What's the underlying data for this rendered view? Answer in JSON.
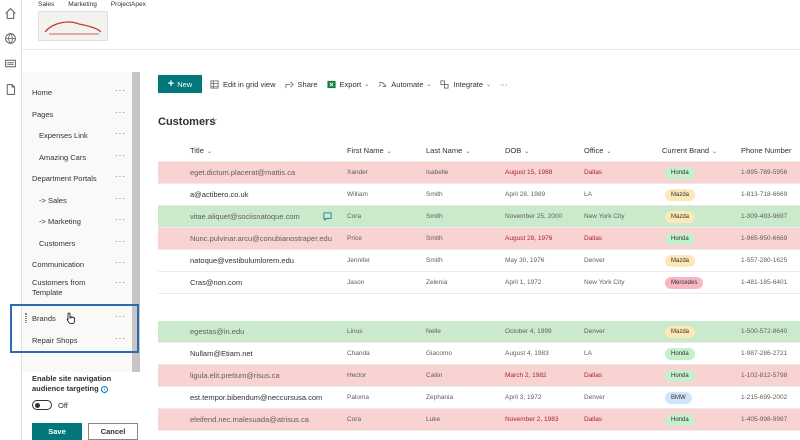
{
  "hub_nav": [
    "Sales",
    "Marketing",
    "ProjectApex"
  ],
  "left_nav": {
    "items": [
      {
        "label": "Home",
        "indent": 0
      },
      {
        "label": "Pages",
        "indent": 0
      },
      {
        "label": "Expenses Link",
        "indent": 1
      },
      {
        "label": "Amazing Cars",
        "indent": 1
      },
      {
        "label": "Department Portals",
        "indent": 0
      },
      {
        "label": "-> Sales",
        "indent": 1
      },
      {
        "label": "-> Marketing",
        "indent": 1
      },
      {
        "label": "Customers",
        "indent": 1
      },
      {
        "label": "Communication",
        "indent": 0
      },
      {
        "label": "Customers from Template",
        "indent": 0
      },
      {
        "label": "Brands",
        "indent": 0
      },
      {
        "label": "Repair Shops",
        "indent": 0
      }
    ],
    "more": "···",
    "audience_label": "Enable site navigation audience targeting",
    "info": "i",
    "toggle_state": "Off",
    "save": "Save",
    "cancel": "Cancel"
  },
  "command_bar": {
    "new": "New",
    "edit_grid": "Edit in grid view",
    "share": "Share",
    "export": "Export",
    "automate": "Automate",
    "integrate": "Integrate",
    "more": "···"
  },
  "list_title": "Customers",
  "columns": [
    "Title",
    "First Name",
    "Last Name",
    "DOB",
    "Office",
    "Current Brand",
    "Phone Number"
  ],
  "brand_colors": {
    "Honda": "#c6efce",
    "Mazda": "#fde9b8",
    "Mercedes": "#f7b6c2",
    "BMW": "#cfe4fa"
  },
  "rows": [
    {
      "color": "red",
      "title": "eget.dictum.placerat@mattis.ca",
      "first": "Xander",
      "last": "Isabelle",
      "dob": "August 15, 1988",
      "office": "Dallas",
      "brand": "Honda",
      "phone": "1-995-789-5956"
    },
    {
      "color": "none",
      "title": "a@actibero.co.uk",
      "first": "William",
      "last": "Smith",
      "dob": "April 28, 1989",
      "office": "LA",
      "brand": "Mazda",
      "phone": "1-813-718-6669"
    },
    {
      "color": "green",
      "title": "vitae.aliquet@sociisnatoque.com",
      "first": "Cora",
      "last": "Smith",
      "dob": "November 25, 2000",
      "office": "New York City",
      "brand": "Mazda",
      "phone": "1-309-493-9697",
      "comment": true
    },
    {
      "color": "red",
      "title": "Nunc.pulvinar.arcu@conubianostraper.edu",
      "first": "Price",
      "last": "Smith",
      "dob": "August 28, 1976",
      "office": "Dallas",
      "brand": "Honda",
      "phone": "1-965-950-6669"
    },
    {
      "color": "none",
      "title": "natoque@vestibulumlorem.edu",
      "first": "Jennifer",
      "last": "Smith",
      "dob": "May 30, 1976",
      "office": "Denver",
      "brand": "Mazda",
      "phone": "1-557-280-1625"
    },
    {
      "color": "none",
      "title": "Cras@non.com",
      "first": "Jason",
      "last": "Zelenia",
      "dob": "April 1, 1972",
      "office": "New York City",
      "brand": "Mercedes",
      "phone": "1-481-185-6401"
    },
    {
      "color": "none",
      "title": "",
      "first": "",
      "last": "",
      "dob": "",
      "office": "",
      "brand": "",
      "phone": ""
    },
    {
      "color": "green",
      "title": "egestas@in.edu",
      "first": "Linus",
      "last": "Nelle",
      "dob": "October 4, 1999",
      "office": "Denver",
      "brand": "Mazda",
      "phone": "1-500-572-8640"
    },
    {
      "color": "none",
      "title": "Nullam@Etiam.net",
      "first": "Chanda",
      "last": "Giacomo",
      "dob": "August 4, 1983",
      "office": "LA",
      "brand": "Honda",
      "phone": "1-987-286-2721"
    },
    {
      "color": "red",
      "title": "ligula.elit.pretium@risus.ca",
      "first": "Hector",
      "last": "Cailin",
      "dob": "March 2, 1982",
      "office": "Dallas",
      "brand": "Honda",
      "phone": "1-102-812-5798"
    },
    {
      "color": "none",
      "title": "est.tempor.bibendum@neccursusa.com",
      "first": "Paloma",
      "last": "Zephania",
      "dob": "April 3, 1972",
      "office": "Denver",
      "brand": "BMW",
      "phone": "1-215-699-2002"
    },
    {
      "color": "red",
      "title": "eleifend.nec.malesuada@atrisus.ca",
      "first": "Cora",
      "last": "Luke",
      "dob": "November 2, 1983",
      "office": "Dallas",
      "brand": "Honda",
      "phone": "1-405-998-9987"
    }
  ]
}
